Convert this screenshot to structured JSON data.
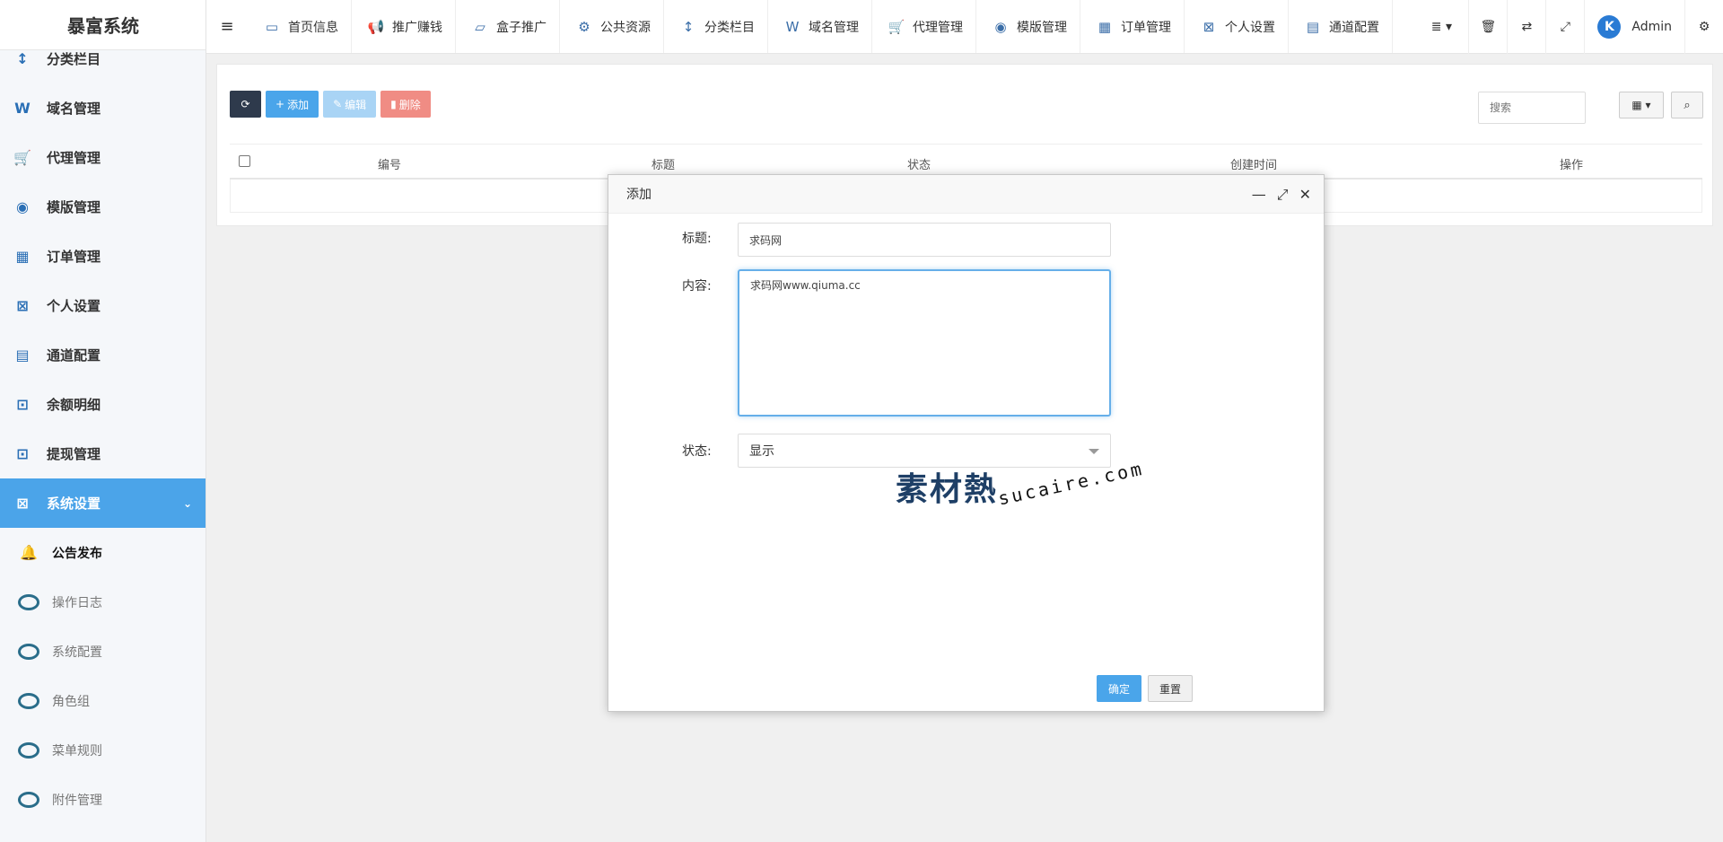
{
  "app": {
    "title": "暴富系统"
  },
  "topnav": {
    "items": [
      {
        "label": "首页信息",
        "icon": "dashboard-icon",
        "glyph": "▭"
      },
      {
        "label": "推广赚钱",
        "icon": "megaphone-icon",
        "glyph": "📢"
      },
      {
        "label": "盒子推广",
        "icon": "box-icon",
        "glyph": "▱"
      },
      {
        "label": "公共资源",
        "icon": "resource-icon",
        "glyph": "⚙"
      },
      {
        "label": "分类栏目",
        "icon": "category-icon",
        "glyph": "↕"
      },
      {
        "label": "域名管理",
        "icon": "domain-icon",
        "glyph": "W"
      },
      {
        "label": "代理管理",
        "icon": "cart-icon",
        "glyph": "🛒"
      },
      {
        "label": "模版管理",
        "icon": "template-icon",
        "glyph": "◉"
      },
      {
        "label": "订单管理",
        "icon": "order-icon",
        "glyph": "▦"
      },
      {
        "label": "个人设置",
        "icon": "personal-settings-icon",
        "glyph": "⊠"
      },
      {
        "label": "通道配置",
        "icon": "channel-icon",
        "glyph": "▤"
      }
    ],
    "user": "Admin"
  },
  "sidebar": {
    "items": [
      {
        "label": "分类栏目",
        "icon": "category-icon",
        "glyph": "↕"
      },
      {
        "label": "域名管理",
        "icon": "domain-icon",
        "glyph": "W"
      },
      {
        "label": "代理管理",
        "icon": "cart-icon",
        "glyph": "🛒"
      },
      {
        "label": "模版管理",
        "icon": "template-icon",
        "glyph": "◉"
      },
      {
        "label": "订单管理",
        "icon": "order-icon",
        "glyph": "▦"
      },
      {
        "label": "个人设置",
        "icon": "personal-settings-icon",
        "glyph": "⊠"
      },
      {
        "label": "通道配置",
        "icon": "channel-icon",
        "glyph": "▤"
      },
      {
        "label": "余额明细",
        "icon": "balance-icon",
        "glyph": "⊡"
      },
      {
        "label": "提现管理",
        "icon": "withdraw-icon",
        "glyph": "⊡"
      },
      {
        "label": "系统设置",
        "icon": "system-settings-icon",
        "glyph": "⊠"
      }
    ],
    "subitems": [
      {
        "label": "公告发布"
      },
      {
        "label": "操作日志"
      },
      {
        "label": "系统配置"
      },
      {
        "label": "角色组"
      },
      {
        "label": "菜单规则"
      },
      {
        "label": "附件管理"
      }
    ]
  },
  "toolbar": {
    "add_label": "添加",
    "edit_label": "编辑",
    "delete_label": "删除",
    "search_placeholder": "搜索"
  },
  "table": {
    "columns": [
      "编号",
      "标题",
      "状态",
      "创建时间",
      "操作"
    ]
  },
  "modal": {
    "title": "添加",
    "title_label": "标题:",
    "title_value": "求码网",
    "content_label": "内容:",
    "content_value": "求码网www.qiuma.cc",
    "status_label": "状态:",
    "status_value": "显示",
    "confirm_label": "确定",
    "reset_label": "重置"
  },
  "watermark": {
    "logo": "素材熱",
    "text": "sucaire.com"
  },
  "colors": {
    "primary": "#4aa5ea",
    "danger": "#f08c84",
    "dark": "#2e3a4c",
    "sidebar_active": "#4ba4e9"
  }
}
